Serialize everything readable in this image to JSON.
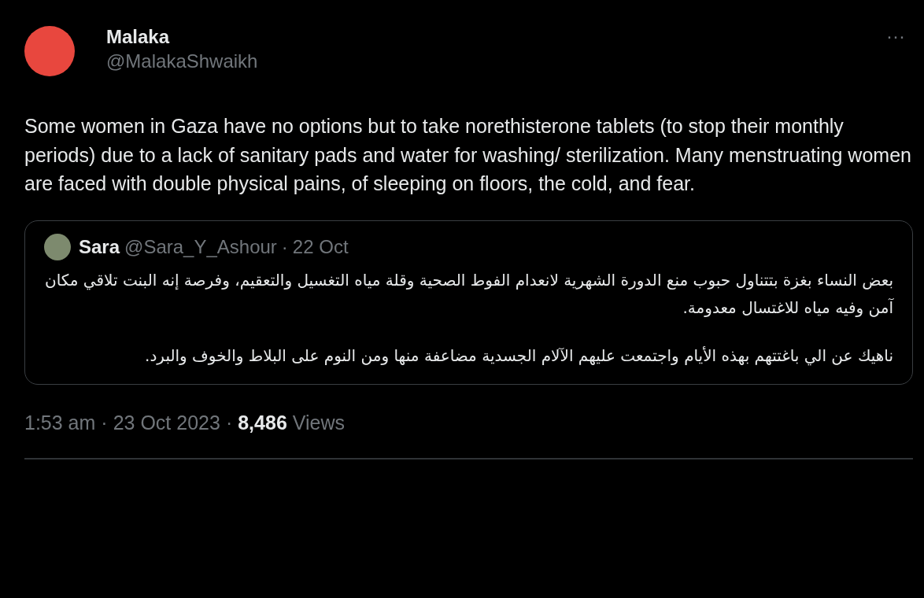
{
  "author": {
    "name": "Malaka",
    "handle": "@MalakaShwaikh"
  },
  "more": "···",
  "text": "Some women in Gaza have no options but to take norethisterone tablets (to stop their monthly periods) due to a lack of sanitary pads and water for washing/ sterilization. Many menstruating women are faced with double physical pains, of sleeping on floors, the cold, and fear.",
  "quote": {
    "name": "Sara",
    "handle": "@Sara_Y_Ashour",
    "separator": "·",
    "date": "22 Oct",
    "paragraphs": [
      "بعض النساء بغزة بتتناول حبوب منع الدورة الشهرية لانعدام الفوط الصحية وقلة مياه التغسيل والتعقيم، وفرصة إنه البنت تلاقي مكان آمن وفيه مياه للاغتسال معدومة.",
      "ناهيك عن الي باغتتهم بهذه الأيام واجتمعت عليهم الآلام الجسدية مضاعفة منها ومن النوم على البلاط والخوف والبرد."
    ]
  },
  "footer": {
    "time": "1:53 am",
    "separator_1": "·",
    "date": "23 Oct 2023",
    "separator_2": "·",
    "views_count": "8,486",
    "views_label": "Views"
  }
}
